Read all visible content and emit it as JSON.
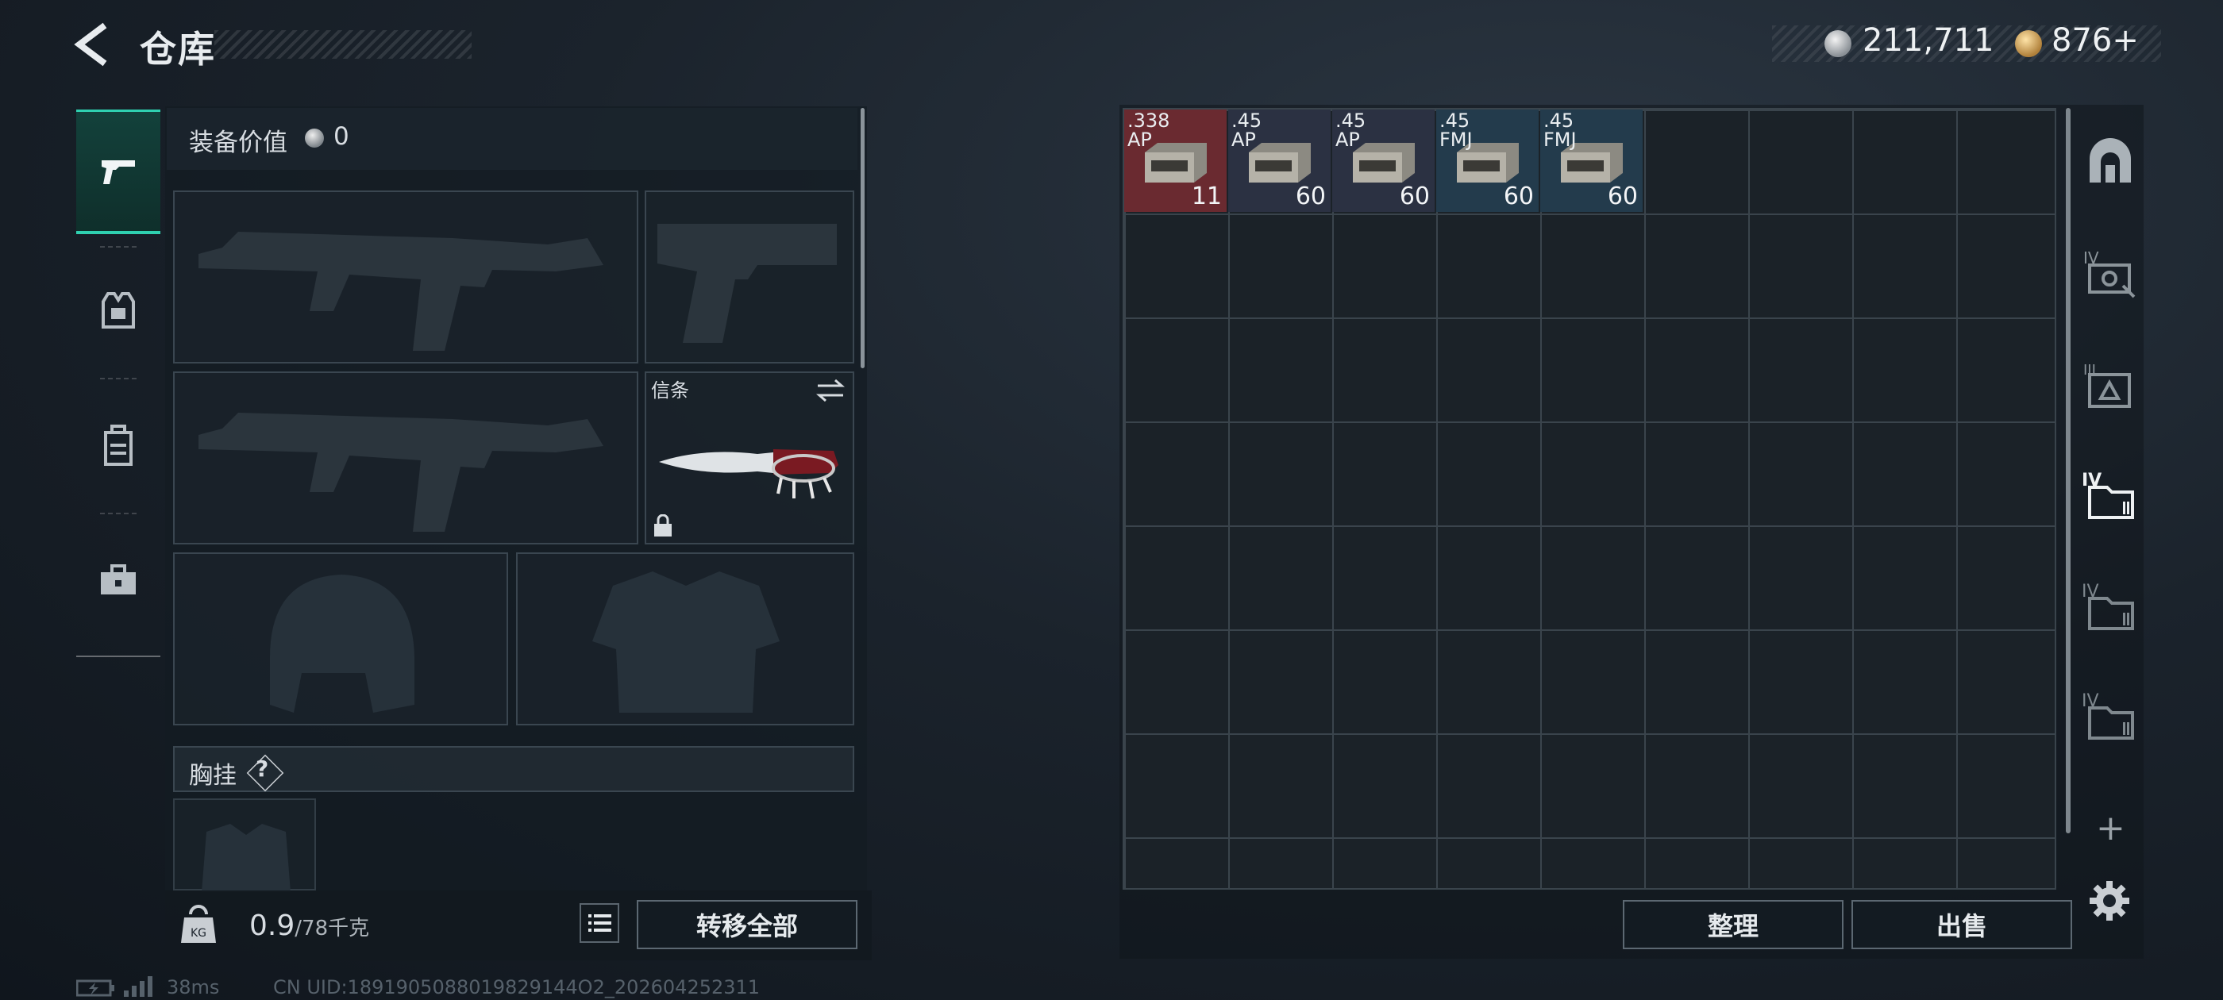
{
  "header": {
    "title": "仓库",
    "currency_silver": "211,711",
    "currency_gold": "876+"
  },
  "equipment": {
    "value_label": "装备价值",
    "value_amount": "0",
    "knife_slot_label": "信条",
    "chest_rig_label": "胸挂",
    "help_mark": "?"
  },
  "footer_left": {
    "weight_value": "0.9",
    "weight_max": "/78千克",
    "transfer_all_label": "转移全部"
  },
  "footer_right": {
    "sort_label": "整理",
    "sell_label": "出售"
  },
  "status": {
    "ping": "38ms",
    "uid": "CN UID:1891905088019829144O2_202604252311"
  },
  "inventory": {
    "items": [
      {
        "name_line1": ".338",
        "name_line2": "AP",
        "count": "11",
        "bg": "#6a2a30"
      },
      {
        "name_line1": ".45",
        "name_line2": "AP",
        "count": "60",
        "bg": "#2b3142"
      },
      {
        "name_line1": ".45",
        "name_line2": "AP",
        "count": "60",
        "bg": "#2b3142"
      },
      {
        "name_line1": ".45",
        "name_line2": "FMJ",
        "count": "60",
        "bg": "#233b4c"
      },
      {
        "name_line1": ".45",
        "name_line2": "FMJ",
        "count": "60",
        "bg": "#233b4c"
      }
    ]
  },
  "sidebar_tabs": [
    "weapons-tab",
    "gear-tab",
    "backpack-tab",
    "case-tab"
  ],
  "side_icons": [
    "safe-box-icon",
    "keycard-case-icon",
    "tier-three-case-icon",
    "tier-four-folder-icon",
    "tier-four-folder-icon",
    "tier-four-folder-icon"
  ],
  "colors": {
    "accent": "#2fd0b0",
    "rare_red": "#6a2a30",
    "blue_item": "#233b4c"
  }
}
